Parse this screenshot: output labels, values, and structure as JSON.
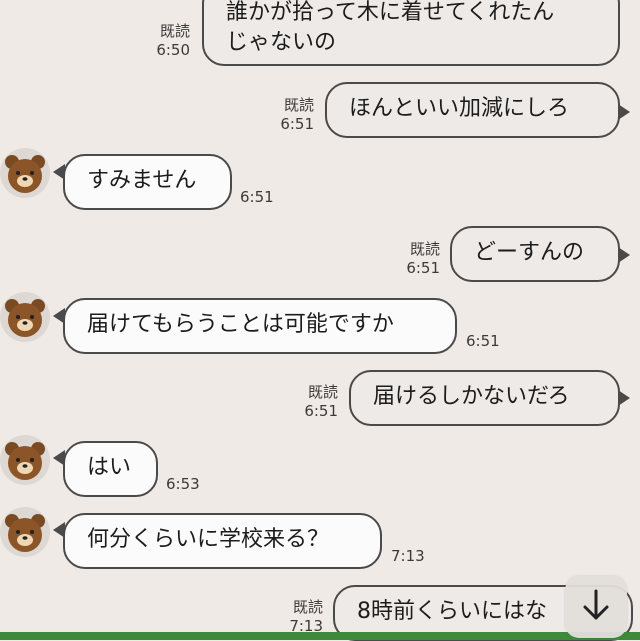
{
  "messages": [
    {
      "side": "out",
      "lines": [
        "誰かが拾って木に着せてくれたん",
        "じゃないの"
      ],
      "status": "既読",
      "time": "6:50"
    },
    {
      "side": "out",
      "lines": [
        "ほんといい加減にしろ"
      ],
      "status": "既読",
      "time": "6:51"
    },
    {
      "side": "in",
      "lines": [
        "すみません"
      ],
      "time": "6:51"
    },
    {
      "side": "out",
      "lines": [
        "どーすんの"
      ],
      "status": "既読",
      "time": "6:51"
    },
    {
      "side": "in",
      "lines": [
        "届けてもらうことは可能ですか"
      ],
      "time": "6:51"
    },
    {
      "side": "out",
      "lines": [
        "届けるしかないだろ"
      ],
      "status": "既読",
      "time": "6:51"
    },
    {
      "side": "in",
      "lines": [
        "はい"
      ],
      "time": "6:53"
    },
    {
      "side": "in",
      "lines": [
        "何分くらいに学校来る？"
      ],
      "time": "7:13"
    },
    {
      "side": "out",
      "lines": [
        "8時前くらいにはな"
      ],
      "status": "既読",
      "time": "7:13"
    }
  ],
  "avatar_icon": "brown-bear-icon",
  "scroll_button_icon": "arrow-down-icon"
}
